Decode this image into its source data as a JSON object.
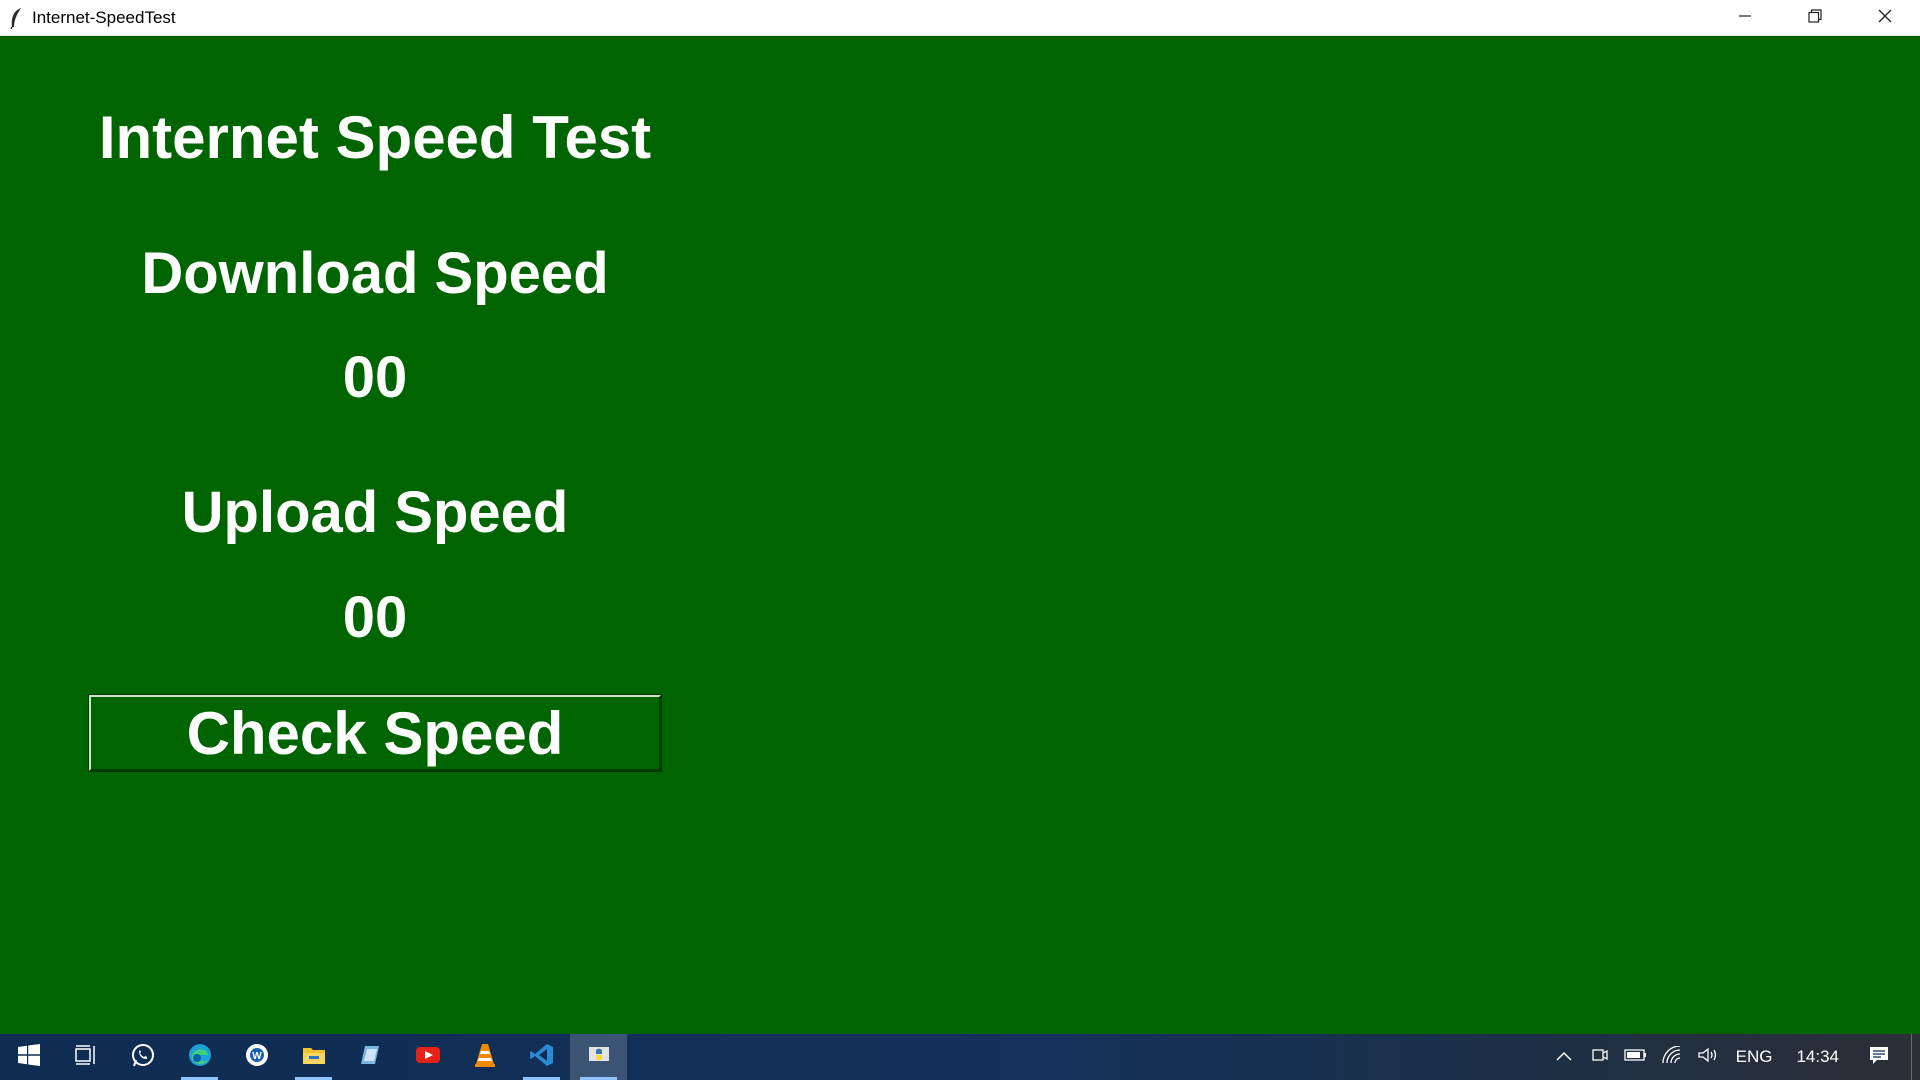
{
  "window": {
    "title": "Internet-SpeedTest",
    "icon": "tk-feather-icon",
    "controls": [
      "minimize-icon",
      "restore-icon",
      "close-icon"
    ]
  },
  "app": {
    "background_color": "#006400",
    "text_color": "#ffffff",
    "title": "Internet Speed Test",
    "download_label": "Download Speed",
    "download_value": "00",
    "upload_label": "Upload Speed",
    "upload_value": "00",
    "check_button_label": "Check Speed"
  },
  "taskbar": {
    "items": [
      {
        "name": "windows-start-icon"
      },
      {
        "name": "task-view-icon"
      },
      {
        "name": "whatsapp-icon"
      },
      {
        "name": "edge-icon",
        "running": true
      },
      {
        "name": "browser-icon"
      },
      {
        "name": "file-explorer-icon",
        "running": true
      },
      {
        "name": "notes-icon"
      },
      {
        "name": "youtube-icon"
      },
      {
        "name": "vlc-icon"
      },
      {
        "name": "vscode-icon",
        "running": true
      },
      {
        "name": "python-icon",
        "active": true
      }
    ],
    "tray": {
      "icons": [
        "chevron-up-icon",
        "meet-now-icon",
        "battery-icon",
        "wifi-icon",
        "volume-icon"
      ],
      "language": "ENG",
      "time": "14:34",
      "notification_icon": "notification-icon"
    }
  }
}
